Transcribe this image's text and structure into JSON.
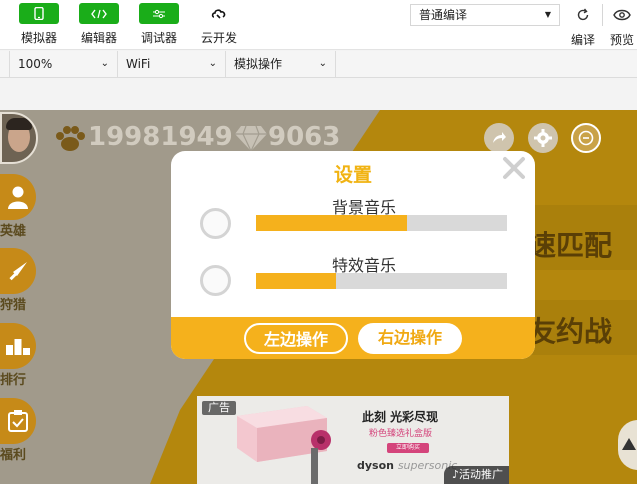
{
  "toolbar": {
    "simulator": "模拟器",
    "editor": "编辑器",
    "debugger": "调试器",
    "cloud": "云开发",
    "compile_mode": "普通编译",
    "compile": "编译",
    "preview": "预览"
  },
  "options": {
    "zoom": "100%",
    "network": "WiFi",
    "sim_action": "模拟操作"
  },
  "game": {
    "stat1": "19981949",
    "stat2": "9063",
    "side_items": [
      "英雄",
      "狩猎",
      "排行",
      "福利"
    ],
    "banner_word1": "速匹配",
    "banner_word2": "友约战"
  },
  "dialog": {
    "title": "设置",
    "bgm_label": "背景音乐",
    "bgm_level": 0.6,
    "sfx_label": "特效音乐",
    "sfx_level": 0.32,
    "left_btn": "左边操作",
    "right_btn": "右边操作"
  },
  "ad": {
    "tag": "广告",
    "headline": "此刻 光彩尽现",
    "subline": "粉色臻选礼盒版",
    "cta": "立即购买",
    "brand": "dyson",
    "brand_sub": "supersonic",
    "promo": "活动推广"
  },
  "colors": {
    "accent": "#f5b11c",
    "wechat_green": "#1aad19",
    "game_bg": "#a19a8b"
  }
}
